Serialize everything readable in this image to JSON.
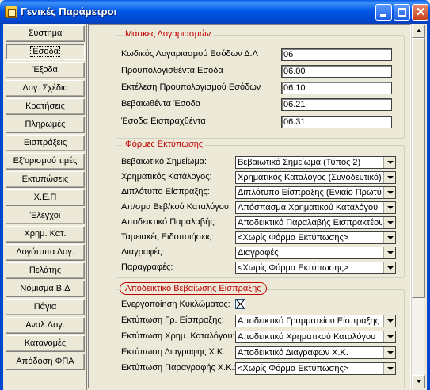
{
  "window": {
    "title": "Γενικές Παράμετροι"
  },
  "sidebar": {
    "items": [
      {
        "label": "Σύστημα"
      },
      {
        "label": "Έσοδα"
      },
      {
        "label": "Έξοδα"
      },
      {
        "label": "Λογ. Σχέδιο"
      },
      {
        "label": "Κρατήσεις"
      },
      {
        "label": "Πληρωμές"
      },
      {
        "label": "Εισπράξεις"
      },
      {
        "label": "Εξ'ορισμού τιμές"
      },
      {
        "label": "Εκτυπώσεις"
      },
      {
        "label": "Χ.Ε.Π"
      },
      {
        "label": "Έλεγχοι"
      },
      {
        "label": "Χρημ. Κατ."
      },
      {
        "label": "Λογότυπα Λογ."
      },
      {
        "label": "Πελάτης"
      },
      {
        "label": "Νόμισμα Β.Δ"
      },
      {
        "label": "Πάγια"
      },
      {
        "label": "Αναλ.Λογ."
      },
      {
        "label": "Κατανομές"
      },
      {
        "label": "Απόδοση ΦΠΑ"
      }
    ],
    "active_index": 1
  },
  "masks": {
    "title": "Μάσκες Λογαριασμών",
    "rows": [
      {
        "label": "Κωδικός Λογαριασμού Εσόδων Δ.Λ",
        "value": "06"
      },
      {
        "label": "Προυπολογισθέντα Εσοδα",
        "value": "06.00"
      },
      {
        "label": "Εκτέλεση Προυπολογισμού Εσόδων",
        "value": "06.10"
      },
      {
        "label": "Βεβαιωθέντα Έσοδα",
        "value": "06.21"
      },
      {
        "label": "Έσοδα Εισπραχθέντα",
        "value": "06.31"
      }
    ]
  },
  "forms": {
    "title": "Φόρμες Εκτύπωσης",
    "rows": [
      {
        "label": "Βεβαιωτικό Σημείωμα:",
        "value": "Βεβαιωτικό Σημείωμα (Τύπος 2)"
      },
      {
        "label": "Χρηματικός Κατάλογος:",
        "value": "Χρηματικός Καταλογος (Συνοδευτικό)"
      },
      {
        "label": "Διπλότυπο Είσπραξης:",
        "value": "Διπλότυπο Είσπραξης (Ενιαίο Πρωτύπου)"
      },
      {
        "label": "Απ/σμα Βεβ/κού Καταλόγου:",
        "value": "Απόσπασμα Χρηματικού Καταλόγου"
      },
      {
        "label": "Αποδεικτικό Παραλαβής:",
        "value": "Αποδεικτικό Παραλαβής Εισπρακτέου"
      },
      {
        "label": "Ταμειακές Ειδοποιήσεις:",
        "value": "<Χωρίς Φόρμα Εκτύπωσης>"
      },
      {
        "label": "Διαγραφές:",
        "value": "Διαγραφές"
      },
      {
        "label": "Παραγραφές:",
        "value": "<Χωρίς Φόρμα Εκτύπωσης>"
      }
    ]
  },
  "receipt": {
    "title": "Αποδεικτικό Βεβαίωσης Είσπραξης",
    "enable_label": "Ενεργοποίηση Κυκλώματος:",
    "enabled": true,
    "rows": [
      {
        "label": "Εκτύπωση Γρ. Είσπραξης:",
        "value": "Αποδεικτικό Γραμματείου Είσπραξης"
      },
      {
        "label": "Εκτύπωση Χρημ. Καταλόγου:",
        "value": "Αποδεικτικό Χρηματικού Καταλόγου"
      },
      {
        "label": "Εκτύπωση Διαγραφής Χ.Κ.:",
        "value": "Αποδεικτικό Διαγραφών Χ.Κ."
      },
      {
        "label": "Εκτύπωση Παραγραφής Χ.Κ.:",
        "value": "<Χωρίς Φόρμα Εκτύπωσης>"
      }
    ]
  }
}
